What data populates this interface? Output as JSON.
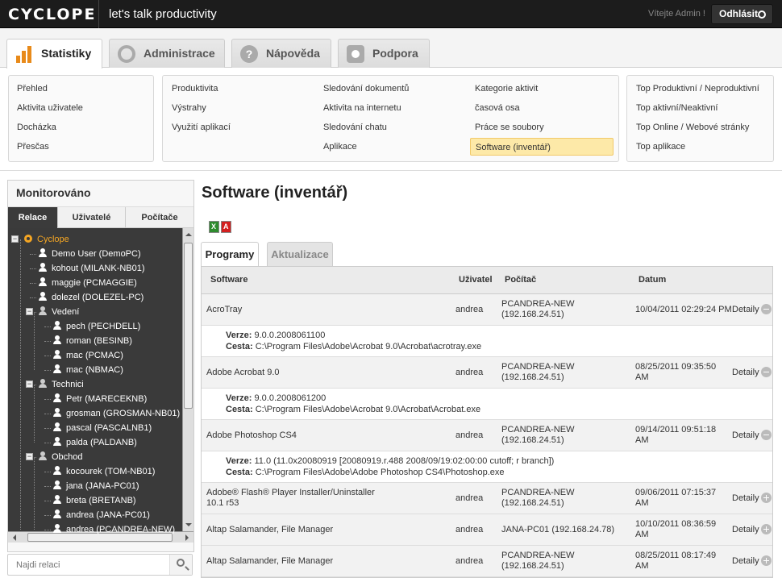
{
  "app": {
    "logo": "CYCLOPE",
    "tagline": "let's talk productivity",
    "welcome": "Vítejte Admin !",
    "logout_label": "Odhlásit"
  },
  "main_tabs": [
    {
      "label": "Statistiky",
      "icon": "bar-chart-icon",
      "active": true
    },
    {
      "label": "Administrace",
      "icon": "cog-icon",
      "active": false
    },
    {
      "label": "Nápověda",
      "icon": "help-icon",
      "active": false
    },
    {
      "label": "Podpora",
      "icon": "support-icon",
      "active": false
    }
  ],
  "submenu": {
    "col1": [
      "Přehled",
      "Aktivita uživatele",
      "Docházka",
      "Přesčas"
    ],
    "col2": [
      "Produktivita",
      "Výstrahy",
      "Využití aplikací"
    ],
    "col3": [
      "Sledování dokumentů",
      "Aktivita na internetu",
      "Sledování chatu",
      "Aplikace"
    ],
    "col4": [
      "Kategorie aktivit",
      "časová osa",
      "Práce se soubory",
      "Software (inventář)"
    ],
    "col5": [
      "Top Produktivní / Neproduktivní",
      "Top aktivní/Neaktivní",
      "Top Online / Webové stránky",
      "Top aplikace"
    ],
    "highlighted": "Software (inventář)"
  },
  "monitor": {
    "title": "Monitorováno",
    "tabs": [
      "Relace",
      "Uživatelé",
      "Počítače"
    ],
    "tree": [
      {
        "label": "Cyclope",
        "level": 0,
        "type": "root"
      },
      {
        "label": "Demo User (DemoPC)",
        "level": 1,
        "type": "user"
      },
      {
        "label": "kohout (MILANK-NB01)",
        "level": 1,
        "type": "user"
      },
      {
        "label": "maggie (PCMAGGIE)",
        "level": 1,
        "type": "user"
      },
      {
        "label": "dolezel (DOLEZEL-PC)",
        "level": 1,
        "type": "user"
      },
      {
        "label": "Vedení",
        "level": 1,
        "type": "group"
      },
      {
        "label": "pech (PECHDELL)",
        "level": 2,
        "type": "user"
      },
      {
        "label": "roman (BESINB)",
        "level": 2,
        "type": "user"
      },
      {
        "label": "mac (PCMAC)",
        "level": 2,
        "type": "user"
      },
      {
        "label": "mac (NBMAC)",
        "level": 2,
        "type": "user"
      },
      {
        "label": "Technici",
        "level": 1,
        "type": "group"
      },
      {
        "label": "Petr (MARECEKNB)",
        "level": 2,
        "type": "user"
      },
      {
        "label": "grosman (GROSMAN-NB01)",
        "level": 2,
        "type": "user"
      },
      {
        "label": "pascal (PASCALNB1)",
        "level": 2,
        "type": "user"
      },
      {
        "label": "palda (PALDANB)",
        "level": 2,
        "type": "user"
      },
      {
        "label": "Obchod",
        "level": 1,
        "type": "group"
      },
      {
        "label": "kocourek (TOM-NB01)",
        "level": 2,
        "type": "user"
      },
      {
        "label": "jana (JANA-PC01)",
        "level": 2,
        "type": "user"
      },
      {
        "label": "breta (BRETANB)",
        "level": 2,
        "type": "user"
      },
      {
        "label": "andrea (JANA-PC01)",
        "level": 2,
        "type": "user"
      },
      {
        "label": "andrea (PCANDREA-NEW)",
        "level": 2,
        "type": "user"
      }
    ],
    "search_placeholder": "Najdi relaci"
  },
  "content": {
    "title": "Software (inventář)",
    "subtabs": [
      "Programy",
      "Aktualizace"
    ],
    "columns": [
      "Software",
      "Uživatel",
      "Počítač",
      "Datum"
    ],
    "detail_label": "Detaily",
    "version_label": "Verze:",
    "path_label": "Cesta:",
    "rows": [
      {
        "software": [
          "AcroTray"
        ],
        "user": "andrea",
        "computer": [
          "PCANDREA-NEW",
          "(192.168.24.51)"
        ],
        "date": [
          "10/04/2011 02:29:24 PM"
        ],
        "expanded": true,
        "version": "9.0.0.2008061100",
        "path": "C:\\Program Files\\Adobe\\Acrobat 9.0\\Acrobat\\acrotray.exe"
      },
      {
        "software": [
          "Adobe Acrobat 9.0"
        ],
        "user": "andrea",
        "computer": [
          "PCANDREA-NEW",
          "(192.168.24.51)"
        ],
        "date": [
          "08/25/2011 09:35:50",
          "AM"
        ],
        "expanded": true,
        "version": "9.0.0.2008061200",
        "path": "C:\\Program Files\\Adobe\\Acrobat 9.0\\Acrobat\\Acrobat.exe"
      },
      {
        "software": [
          "Adobe Photoshop CS4"
        ],
        "user": "andrea",
        "computer": [
          "PCANDREA-NEW",
          "(192.168.24.51)"
        ],
        "date": [
          "09/14/2011 09:51:18",
          "AM"
        ],
        "expanded": true,
        "version": "11.0 (11.0x20080919 [20080919.r.488 2008/09/19:02:00:00 cutoff; r branch])",
        "path": "C:\\Program Files\\Adobe\\Adobe Photoshop CS4\\Photoshop.exe"
      },
      {
        "software": [
          "Adobe® Flash® Player Installer/Uninstaller",
          "10.1 r53"
        ],
        "user": "andrea",
        "computer": [
          "PCANDREA-NEW",
          "(192.168.24.51)"
        ],
        "date": [
          "09/06/2011 07:15:37",
          "AM"
        ],
        "expanded": false
      },
      {
        "software": [
          "Altap Salamander, File Manager"
        ],
        "user": "andrea",
        "computer": [
          "JANA-PC01 (192.168.24.78)"
        ],
        "date": [
          "10/10/2011 08:36:59",
          "AM"
        ],
        "expanded": false
      },
      {
        "software": [
          "Altap Salamander, File Manager"
        ],
        "user": "andrea",
        "computer": [
          "PCANDREA-NEW",
          "(192.168.24.51)"
        ],
        "date": [
          "08/25/2011 08:17:49",
          "AM"
        ],
        "expanded": false
      }
    ]
  },
  "colors": {
    "accent": "#f5a623",
    "topbar": "#1c1c1c",
    "highlight": "#fde9a8"
  }
}
